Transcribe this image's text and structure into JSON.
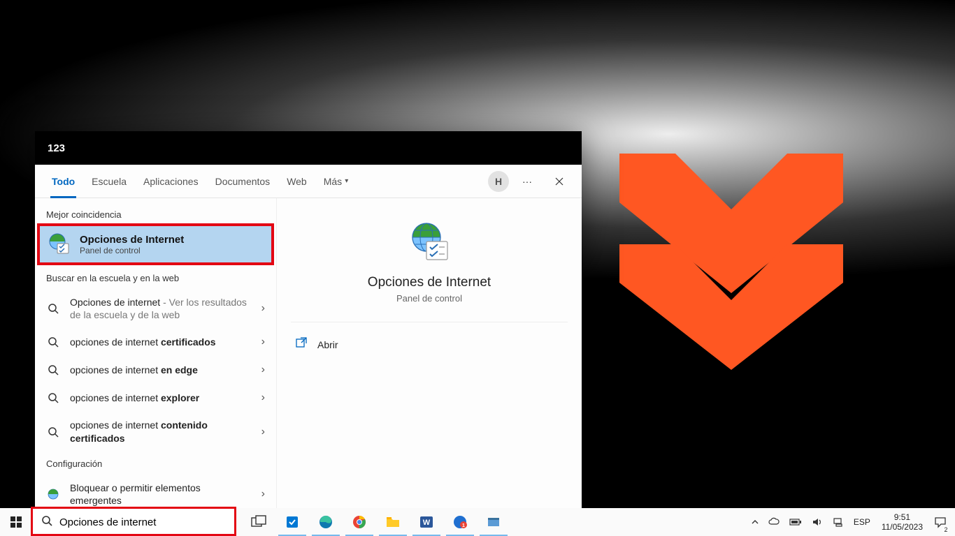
{
  "wallpaper": {
    "accent": "#ff5722"
  },
  "search_panel": {
    "title": "123",
    "tabs": [
      "Todo",
      "Escuela",
      "Aplicaciones",
      "Documentos",
      "Web",
      "Más"
    ],
    "active_tab_index": 0,
    "user_initial": "H",
    "sections": {
      "best_match_label": "Mejor coincidencia",
      "best_match": {
        "title": "Opciones de Internet",
        "subtitle": "Panel de control"
      },
      "web_label": "Buscar en la escuela y en la web",
      "web_items": [
        {
          "prefix": "Opciones de internet",
          "suffix": "",
          "extra": " - Ver los resultados de la escuela y de la web"
        },
        {
          "prefix": "opciones de internet ",
          "suffix": "certificados",
          "extra": ""
        },
        {
          "prefix": "opciones de internet ",
          "suffix": "en edge",
          "extra": ""
        },
        {
          "prefix": "opciones de internet ",
          "suffix": "explorer",
          "extra": ""
        },
        {
          "prefix": "opciones de internet ",
          "suffix": "contenido certificados",
          "extra": ""
        }
      ],
      "settings_label": "Configuración",
      "settings_items": [
        {
          "text": "Bloquear o permitir elementos emergentes"
        }
      ]
    },
    "preview": {
      "title": "Opciones de Internet",
      "subtitle": "Panel de control",
      "open_label": "Abrir"
    }
  },
  "taskbar": {
    "search_value": "Opciones de internet",
    "language": "ESP",
    "time": "9:51",
    "date": "11/05/2023",
    "notif_count": "2"
  }
}
